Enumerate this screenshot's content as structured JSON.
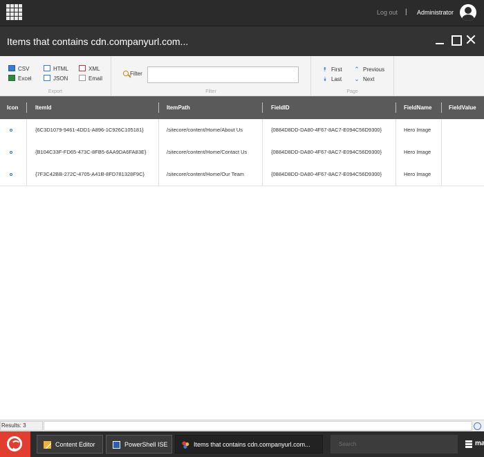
{
  "topbar": {
    "logout_label": "Log out",
    "separator": "|",
    "user_label": "Administrator"
  },
  "window": {
    "title": "Items that contains cdn.companyurl.com..."
  },
  "ribbon": {
    "export": {
      "label": "Export",
      "csv": "CSV",
      "excel": "Excel",
      "html": "HTML",
      "json": "JSON",
      "xml": "XML",
      "email": "Email"
    },
    "filter": {
      "label": "Filter",
      "button_label": "Filter",
      "value": ""
    },
    "page": {
      "label": "Page",
      "first": "First",
      "last": "Last",
      "previous": "Previous",
      "next": "Next"
    }
  },
  "grid": {
    "columns": [
      "Icon",
      "ItemId",
      "ItemPath",
      "FieldID",
      "FieldName",
      "FieldValue"
    ],
    "rows": [
      {
        "item_id": "{6C3D1079-9461-4DD1-A896-1C926C105181}",
        "item_path": "/sitecore/content/Home/About Us",
        "field_id": "{0884D8DD-DA80-4F67-8AC7-E094C56D9300}",
        "field_name": "Hero Image",
        "field_value": ""
      },
      {
        "item_id": "{B104C33F-FD65-473C-8FB5-6AA9DA6FA83E}",
        "item_path": "/sitecore/content/Home/Contact Us",
        "field_id": "{0884D8DD-DA80-4F67-8AC7-E094C56D9300}",
        "field_name": "Hero Image",
        "field_value": ""
      },
      {
        "item_id": "{7F3C42BB-272C-4705-A41B-8FD781328F9C}",
        "item_path": "/sitecore/content/Home/Our Team",
        "field_id": "{0884D8DD-DA80-4F67-8AC7-E094C56D9300}",
        "field_name": "Hero Image",
        "field_value": ""
      }
    ]
  },
  "status": {
    "results": "Results: 3"
  },
  "taskbar": {
    "content_editor": "Content Editor",
    "powershell_ise": "PowerShell ISE",
    "active_window": "Items that contains cdn.companyurl.com...",
    "search_placeholder": "Search",
    "tray_text": "ma"
  }
}
